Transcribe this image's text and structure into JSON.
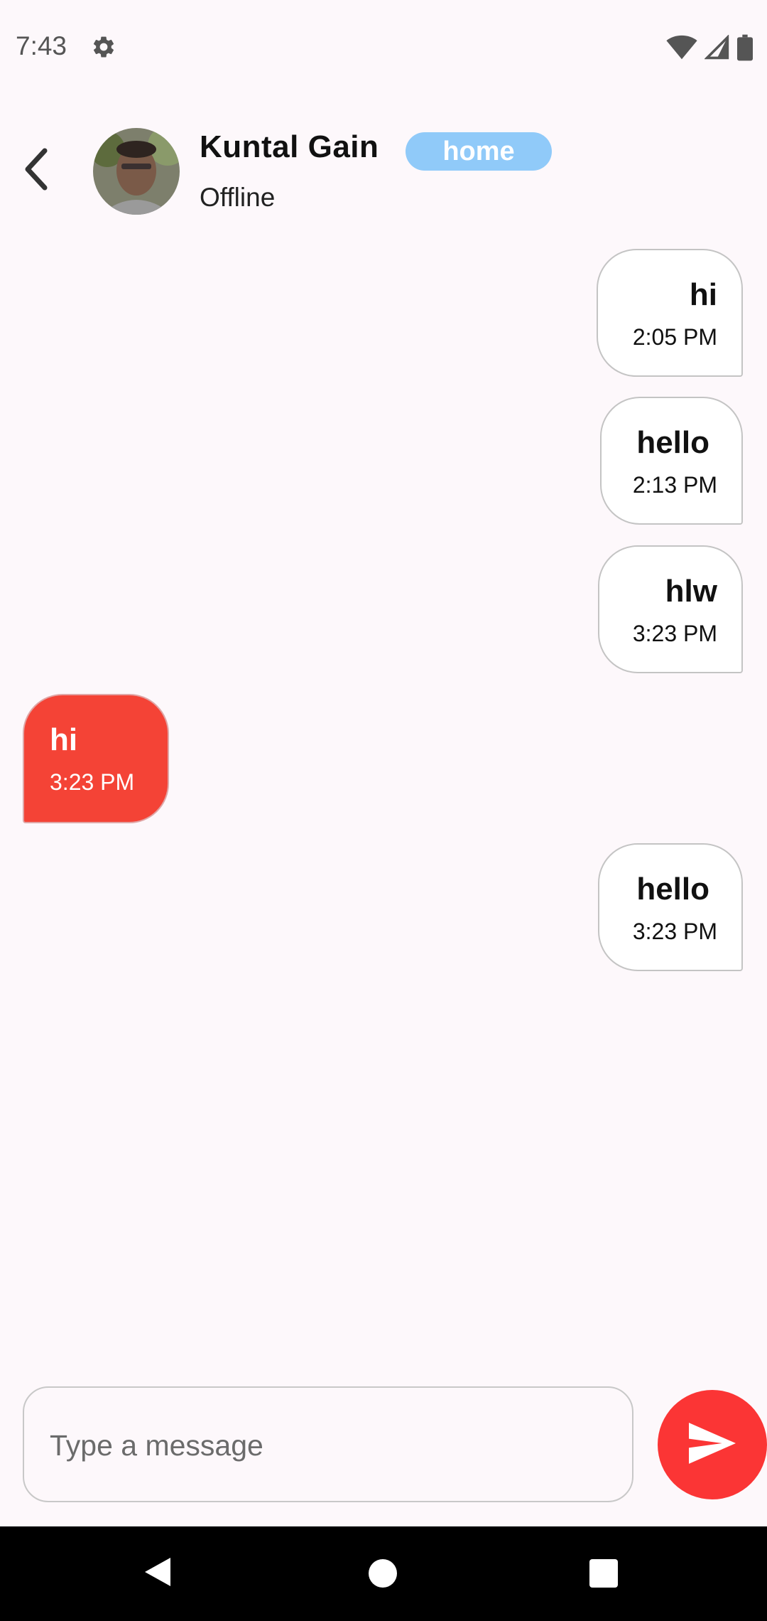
{
  "status_bar": {
    "time": "7:43"
  },
  "header": {
    "contact_name": "Kuntal Gain",
    "badge": "home",
    "status": "Offline"
  },
  "messages": [
    {
      "direction": "out",
      "text": "hi",
      "time": "2:05 PM"
    },
    {
      "direction": "out",
      "text": "hello",
      "time": "2:13 PM"
    },
    {
      "direction": "out",
      "text": "hlw",
      "time": "3:23 PM"
    },
    {
      "direction": "in",
      "text": "hi",
      "time": "3:23 PM"
    },
    {
      "direction": "out",
      "text": "hello",
      "time": "3:23 PM"
    }
  ],
  "composer": {
    "placeholder": "Type a message",
    "value": ""
  },
  "icons": {
    "settings": "gear-icon",
    "wifi": "wifi-icon",
    "signal": "signal-icon",
    "battery": "battery-icon",
    "back": "chevron-left-icon",
    "send": "send-icon",
    "nav_back": "nav-back-icon",
    "nav_home": "nav-home-icon",
    "nav_recents": "nav-recents-icon"
  },
  "colors": {
    "incoming_bubble": "#f44336",
    "badge": "#90caf9",
    "send_button": "#fb3535",
    "background": "#fdf8fb"
  }
}
